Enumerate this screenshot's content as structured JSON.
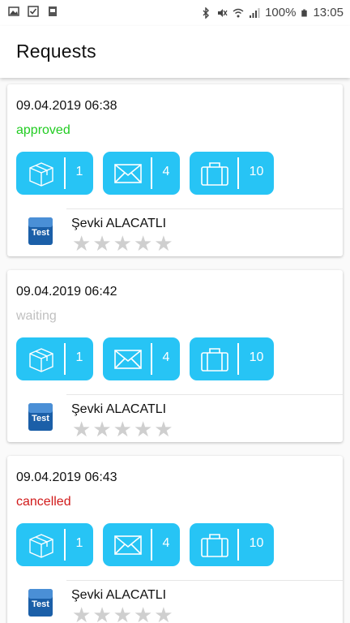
{
  "status_bar": {
    "battery": "100%",
    "time": "13:05"
  },
  "appbar": {
    "title": "Requests"
  },
  "requests": [
    {
      "date": "09.04.2019 06:38",
      "status": "approved",
      "status_color": "#22cc22",
      "box_count": "1",
      "mail_count": "4",
      "bag_count": "10",
      "name": "Şevki ALACATLI",
      "rating": 0,
      "logo_text": "Test"
    },
    {
      "date": "09.04.2019 06:42",
      "status": "waiting",
      "status_color": "#c0c0c0",
      "box_count": "1",
      "mail_count": "4",
      "bag_count": "10",
      "name": "Şevki ALACATLI",
      "rating": 0,
      "logo_text": "Test"
    },
    {
      "date": "09.04.2019 06:43",
      "status": "cancelled",
      "status_color": "#d11a1a",
      "box_count": "1",
      "mail_count": "4",
      "bag_count": "10",
      "name": "Şevki ALACATLI",
      "rating": 0,
      "logo_text": "Test"
    }
  ],
  "icons": {
    "box": "package-icon",
    "mail": "envelope-icon",
    "bag": "suitcase-icon",
    "star": "star-icon"
  },
  "colors": {
    "accent": "#27c4f5"
  }
}
